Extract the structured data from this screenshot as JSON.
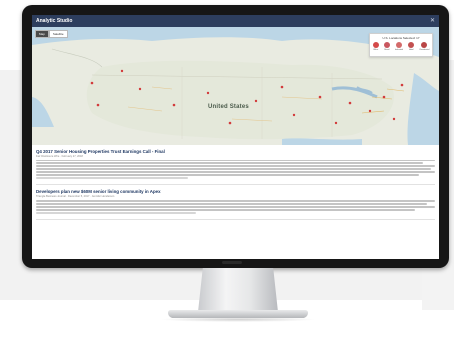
{
  "app": {
    "title": "Analytic Studio",
    "close_glyph": "✕"
  },
  "map": {
    "tabs": [
      {
        "label": "Map",
        "active": true
      },
      {
        "label": "Satellite",
        "active": false
      }
    ],
    "country_label": "United States",
    "legend": {
      "title": "U.S. Locations Selected: 17",
      "items": [
        {
          "label": "Office",
          "color": "#d44a4a"
        },
        {
          "label": "Retail",
          "color": "#c9575f"
        },
        {
          "label": "Industrial",
          "color": "#d36a6a"
        },
        {
          "label": "Hotel",
          "color": "#c25050"
        },
        {
          "label": "Residential",
          "color": "#b94646"
        }
      ]
    },
    "pin_color": "#d23b3b"
  },
  "articles": [
    {
      "title": "Q4 2017 Senior Housing Properties Trust Earnings Call - Final",
      "meta": "Fair Disclosure Wire · February 27, 2018"
    },
    {
      "title": "Developers plan new $60M senior living community in Apex",
      "meta": "Triangle Business Journal · December 5, 2017 · Jennifer Henderson"
    }
  ]
}
